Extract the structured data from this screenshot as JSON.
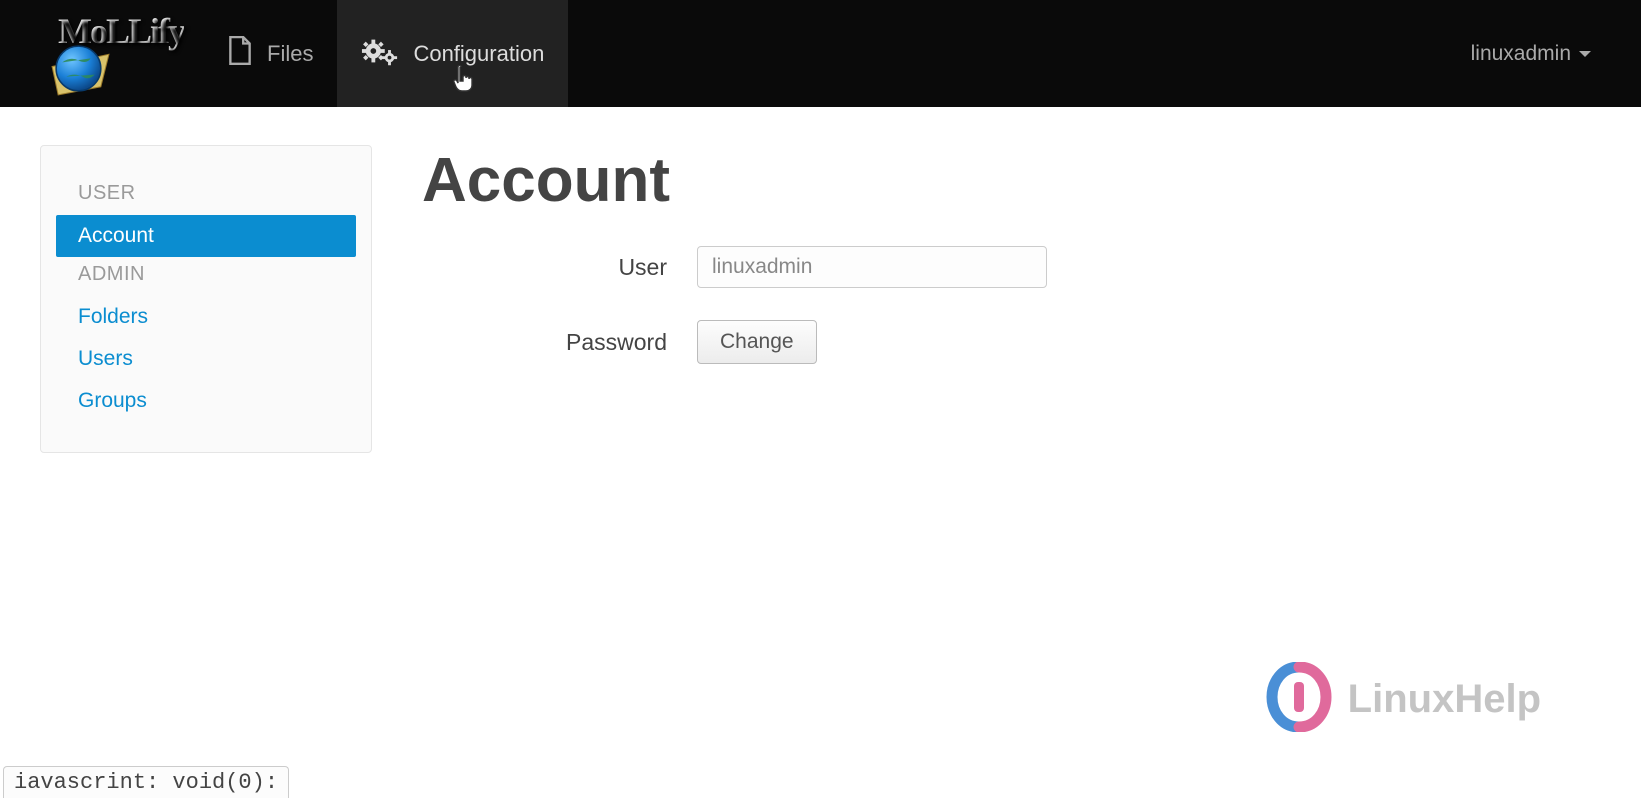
{
  "brand": {
    "name": "MoLLify"
  },
  "nav": {
    "files_label": "Files",
    "config_label": "Configuration",
    "username": "linuxadmin"
  },
  "sidebar": {
    "heading_user": "USER",
    "heading_admin": "ADMIN",
    "items": {
      "account": "Account",
      "folders": "Folders",
      "users": "Users",
      "groups": "Groups"
    }
  },
  "content": {
    "title": "Account",
    "user_label": "User",
    "user_value": "linuxadmin",
    "password_label": "Password",
    "change_button": "Change"
  },
  "footer": {
    "linuxhelp": "LinuxHelp",
    "status_text": "iavascrint: void(0):"
  }
}
